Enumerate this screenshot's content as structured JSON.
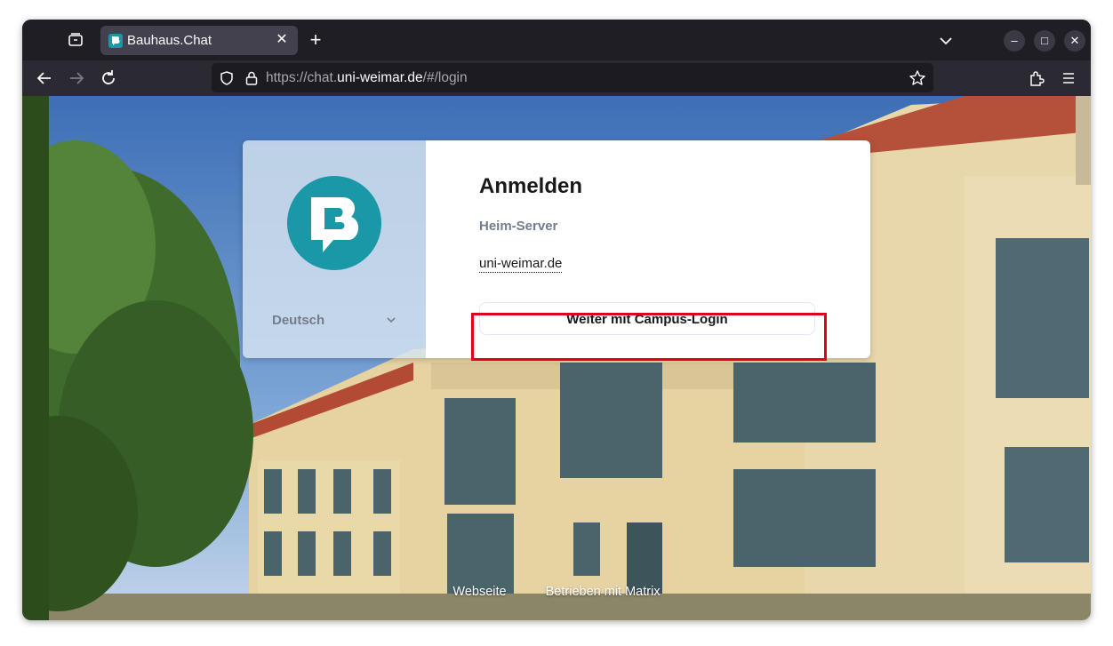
{
  "browser": {
    "tab": {
      "title": "Bauhaus.Chat",
      "close_glyph": "✕"
    },
    "new_tab_glyph": "+",
    "window_controls": {
      "minimize": "–",
      "maximize": "□",
      "close": "✕"
    },
    "url": {
      "prefix": "https://chat.",
      "host": "uni-weimar.de",
      "path": "/#/login"
    }
  },
  "login": {
    "heading": "Anmelden",
    "homeserver_label": "Heim-Server",
    "homeserver_value": "uni-weimar.de",
    "campus_login_button": "Weiter mit Campus-Login",
    "language": "Deutsch"
  },
  "footer": {
    "links": [
      "Webseite",
      "Betrieben mit Matrix"
    ]
  },
  "colors": {
    "brand": "#1a98a8",
    "highlight": "#e0001b",
    "card_bg": "#ffffff"
  }
}
